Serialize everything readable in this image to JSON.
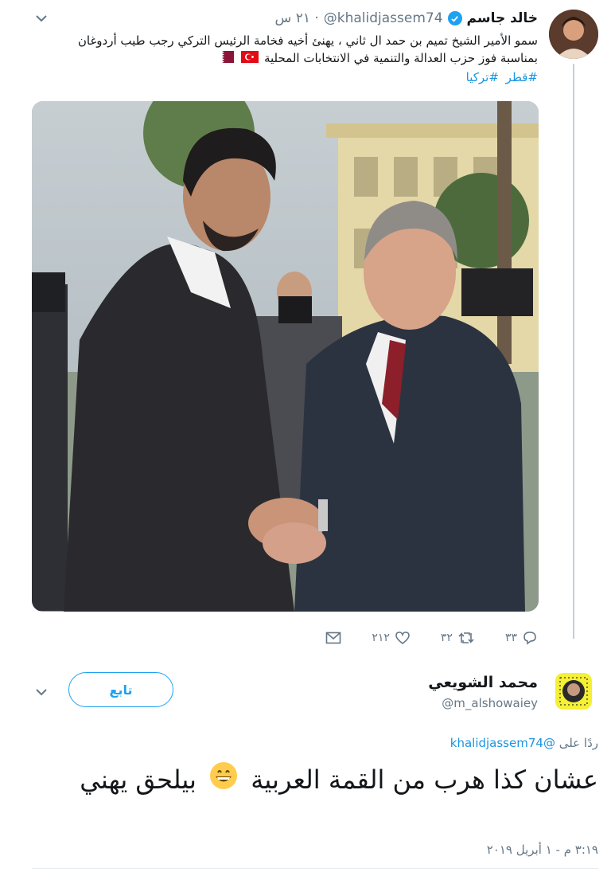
{
  "tweet": {
    "author_name": "خالد جاسم",
    "handle": "@khalidjassem74",
    "time": "· ٢١ س",
    "text": "سمو الأمير الشيخ تميم بن حمد ال ثاني ، يهنئ أخيه فخامة الرئيس التركي رجب طيب أردوغان بمناسبة فوز حزب العدالة والتنمية في الانتخابات المحلية",
    "hashtags": [
      "#قطر",
      "#تركيا"
    ],
    "flags": [
      "turkey-flag",
      "qatar-flag"
    ],
    "actions": {
      "reply_count": "٣٣",
      "retweet_count": "٣٢",
      "like_count": "٢١٢"
    }
  },
  "reply": {
    "author_name": "محمد الشويعي",
    "handle": "@m_alshowaiey",
    "follow_label": "تابع",
    "replying_to_label": "ردًا على",
    "replying_to_handle": "@khalidjassem74",
    "text_before_emoji": "عشان كذا هرب من القمة العربية",
    "text_after_emoji": "بيلحق يهني",
    "timestamp": "٣:١٩ م - ١ أبريل ٢٠١٩"
  },
  "colors": {
    "link": "#1b95e0",
    "accent": "#1da1f2",
    "muted": "#657786",
    "text": "#14171a"
  }
}
